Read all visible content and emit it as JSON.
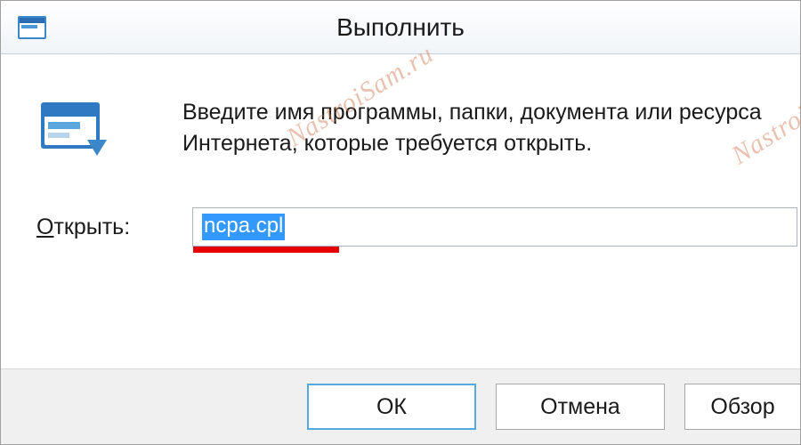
{
  "titlebar": {
    "title": "Выполнить"
  },
  "content": {
    "description": "Введите имя программы, папки, документа или ресурса Интернета, которые требуется открыть.",
    "open_label_prefix": "О",
    "open_label_rest": "ткрыть:",
    "input_value": "ncpa.cpl"
  },
  "buttons": {
    "ok": "ОК",
    "cancel": "Отмена",
    "browse": "Обзор"
  },
  "watermark": {
    "text": "NastroiSam.ru"
  },
  "icons": {
    "run": "run-icon",
    "window": "window-icon"
  }
}
